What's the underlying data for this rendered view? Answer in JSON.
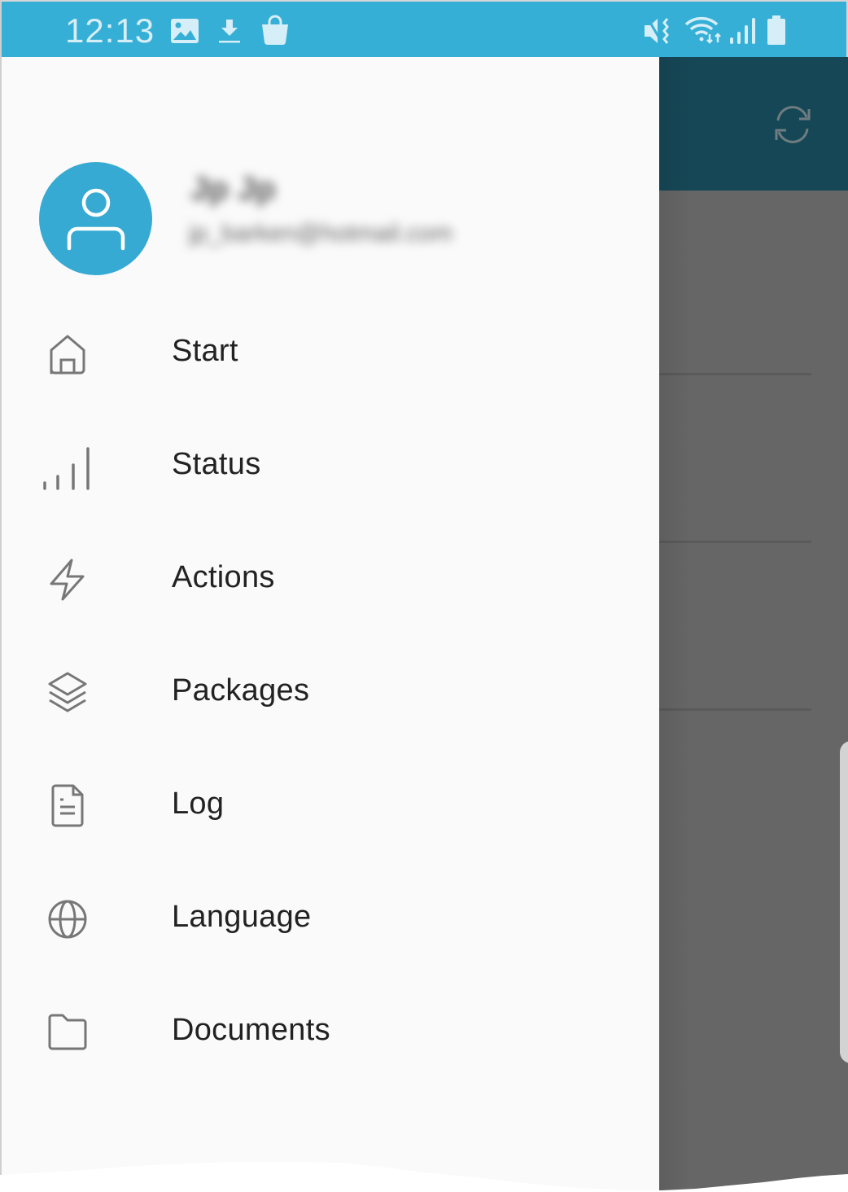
{
  "status_bar": {
    "time": "12:13",
    "left_icons": [
      "image-icon",
      "download-icon",
      "shopping-bag-icon"
    ],
    "right_icons": [
      "vibrate-mute-icon",
      "wifi-icon",
      "cellular-signal-icon",
      "battery-icon"
    ],
    "background_color": "#36afd6"
  },
  "app_bar": {
    "background_color": "#164756",
    "refresh_icon": "refresh-icon"
  },
  "drawer": {
    "user": {
      "name": "Jp Jp",
      "email": "jp_barken@hotmail.com",
      "avatar_icon": "user-icon",
      "avatar_color": "#36aad3",
      "blurred": true
    },
    "items": [
      {
        "label": "Start",
        "icon": "home-icon"
      },
      {
        "label": "Status",
        "icon": "signal-bars-icon"
      },
      {
        "label": "Actions",
        "icon": "lightning-icon"
      },
      {
        "label": "Packages",
        "icon": "layers-icon"
      },
      {
        "label": "Log",
        "icon": "document-icon"
      },
      {
        "label": "Language",
        "icon": "globe-icon"
      },
      {
        "label": "Documents",
        "icon": "folder-icon"
      }
    ]
  }
}
